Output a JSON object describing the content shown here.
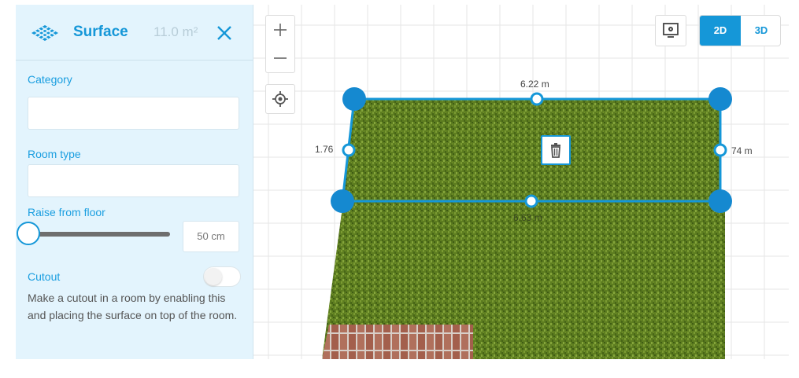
{
  "panel": {
    "title": "Surface",
    "area": "11.0 m²",
    "category_label": "Category",
    "category_value": "",
    "room_type_label": "Room type",
    "room_type_value": "",
    "raise_label": "Raise from floor",
    "raise_value": "50 cm",
    "raise_level": 0,
    "cutout_label": "Cutout",
    "cutout_enabled": false,
    "cutout_desc": "Make a cutout in a room by enabling this and placing the surface on top of the room."
  },
  "canvas": {
    "view_options": [
      "2D",
      "3D"
    ],
    "active_view": "2D",
    "dimensions": {
      "top": "6.22 m",
      "left": "1.76",
      "right": "74 m",
      "bottom": "6.63 m"
    }
  },
  "colors": {
    "accent": "#1597d8",
    "panel_bg": "#e3f4fd",
    "grass": "#5a7a1f",
    "brick": "#a86a55"
  },
  "icons": [
    "surface-icon",
    "close-icon",
    "zoom-in-icon",
    "zoom-out-icon",
    "locate-icon",
    "monitor-icon",
    "trash-icon",
    "dropdown-caret-icon"
  ]
}
